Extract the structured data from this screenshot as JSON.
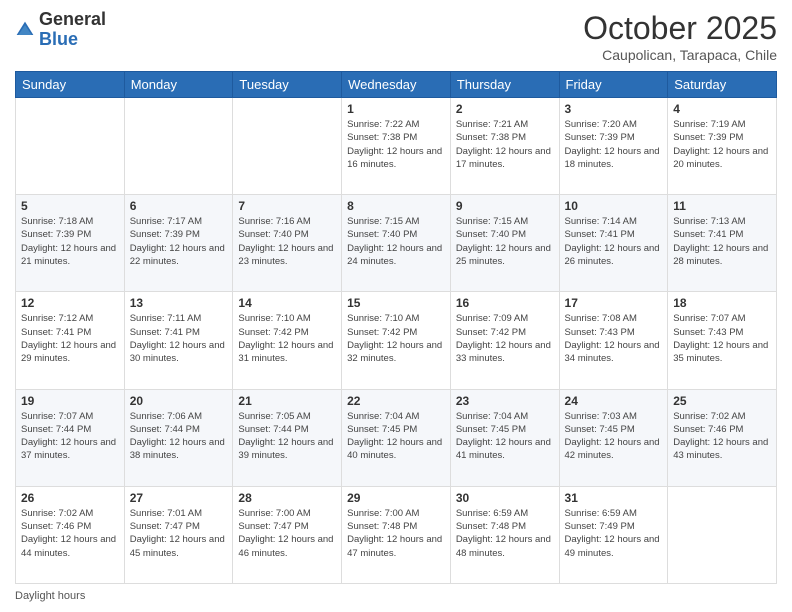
{
  "header": {
    "logo_general": "General",
    "logo_blue": "Blue",
    "month_title": "October 2025",
    "location": "Caupolican, Tarapaca, Chile"
  },
  "footer": {
    "daylight_label": "Daylight hours"
  },
  "days_of_week": [
    "Sunday",
    "Monday",
    "Tuesday",
    "Wednesday",
    "Thursday",
    "Friday",
    "Saturday"
  ],
  "weeks": [
    [
      {
        "day": "",
        "info": ""
      },
      {
        "day": "",
        "info": ""
      },
      {
        "day": "",
        "info": ""
      },
      {
        "day": "1",
        "info": "Sunrise: 7:22 AM\nSunset: 7:38 PM\nDaylight: 12 hours and 16 minutes."
      },
      {
        "day": "2",
        "info": "Sunrise: 7:21 AM\nSunset: 7:38 PM\nDaylight: 12 hours and 17 minutes."
      },
      {
        "day": "3",
        "info": "Sunrise: 7:20 AM\nSunset: 7:39 PM\nDaylight: 12 hours and 18 minutes."
      },
      {
        "day": "4",
        "info": "Sunrise: 7:19 AM\nSunset: 7:39 PM\nDaylight: 12 hours and 20 minutes."
      }
    ],
    [
      {
        "day": "5",
        "info": "Sunrise: 7:18 AM\nSunset: 7:39 PM\nDaylight: 12 hours and 21 minutes."
      },
      {
        "day": "6",
        "info": "Sunrise: 7:17 AM\nSunset: 7:39 PM\nDaylight: 12 hours and 22 minutes."
      },
      {
        "day": "7",
        "info": "Sunrise: 7:16 AM\nSunset: 7:40 PM\nDaylight: 12 hours and 23 minutes."
      },
      {
        "day": "8",
        "info": "Sunrise: 7:15 AM\nSunset: 7:40 PM\nDaylight: 12 hours and 24 minutes."
      },
      {
        "day": "9",
        "info": "Sunrise: 7:15 AM\nSunset: 7:40 PM\nDaylight: 12 hours and 25 minutes."
      },
      {
        "day": "10",
        "info": "Sunrise: 7:14 AM\nSunset: 7:41 PM\nDaylight: 12 hours and 26 minutes."
      },
      {
        "day": "11",
        "info": "Sunrise: 7:13 AM\nSunset: 7:41 PM\nDaylight: 12 hours and 28 minutes."
      }
    ],
    [
      {
        "day": "12",
        "info": "Sunrise: 7:12 AM\nSunset: 7:41 PM\nDaylight: 12 hours and 29 minutes."
      },
      {
        "day": "13",
        "info": "Sunrise: 7:11 AM\nSunset: 7:41 PM\nDaylight: 12 hours and 30 minutes."
      },
      {
        "day": "14",
        "info": "Sunrise: 7:10 AM\nSunset: 7:42 PM\nDaylight: 12 hours and 31 minutes."
      },
      {
        "day": "15",
        "info": "Sunrise: 7:10 AM\nSunset: 7:42 PM\nDaylight: 12 hours and 32 minutes."
      },
      {
        "day": "16",
        "info": "Sunrise: 7:09 AM\nSunset: 7:42 PM\nDaylight: 12 hours and 33 minutes."
      },
      {
        "day": "17",
        "info": "Sunrise: 7:08 AM\nSunset: 7:43 PM\nDaylight: 12 hours and 34 minutes."
      },
      {
        "day": "18",
        "info": "Sunrise: 7:07 AM\nSunset: 7:43 PM\nDaylight: 12 hours and 35 minutes."
      }
    ],
    [
      {
        "day": "19",
        "info": "Sunrise: 7:07 AM\nSunset: 7:44 PM\nDaylight: 12 hours and 37 minutes."
      },
      {
        "day": "20",
        "info": "Sunrise: 7:06 AM\nSunset: 7:44 PM\nDaylight: 12 hours and 38 minutes."
      },
      {
        "day": "21",
        "info": "Sunrise: 7:05 AM\nSunset: 7:44 PM\nDaylight: 12 hours and 39 minutes."
      },
      {
        "day": "22",
        "info": "Sunrise: 7:04 AM\nSunset: 7:45 PM\nDaylight: 12 hours and 40 minutes."
      },
      {
        "day": "23",
        "info": "Sunrise: 7:04 AM\nSunset: 7:45 PM\nDaylight: 12 hours and 41 minutes."
      },
      {
        "day": "24",
        "info": "Sunrise: 7:03 AM\nSunset: 7:45 PM\nDaylight: 12 hours and 42 minutes."
      },
      {
        "day": "25",
        "info": "Sunrise: 7:02 AM\nSunset: 7:46 PM\nDaylight: 12 hours and 43 minutes."
      }
    ],
    [
      {
        "day": "26",
        "info": "Sunrise: 7:02 AM\nSunset: 7:46 PM\nDaylight: 12 hours and 44 minutes."
      },
      {
        "day": "27",
        "info": "Sunrise: 7:01 AM\nSunset: 7:47 PM\nDaylight: 12 hours and 45 minutes."
      },
      {
        "day": "28",
        "info": "Sunrise: 7:00 AM\nSunset: 7:47 PM\nDaylight: 12 hours and 46 minutes."
      },
      {
        "day": "29",
        "info": "Sunrise: 7:00 AM\nSunset: 7:48 PM\nDaylight: 12 hours and 47 minutes."
      },
      {
        "day": "30",
        "info": "Sunrise: 6:59 AM\nSunset: 7:48 PM\nDaylight: 12 hours and 48 minutes."
      },
      {
        "day": "31",
        "info": "Sunrise: 6:59 AM\nSunset: 7:49 PM\nDaylight: 12 hours and 49 minutes."
      },
      {
        "day": "",
        "info": ""
      }
    ]
  ]
}
